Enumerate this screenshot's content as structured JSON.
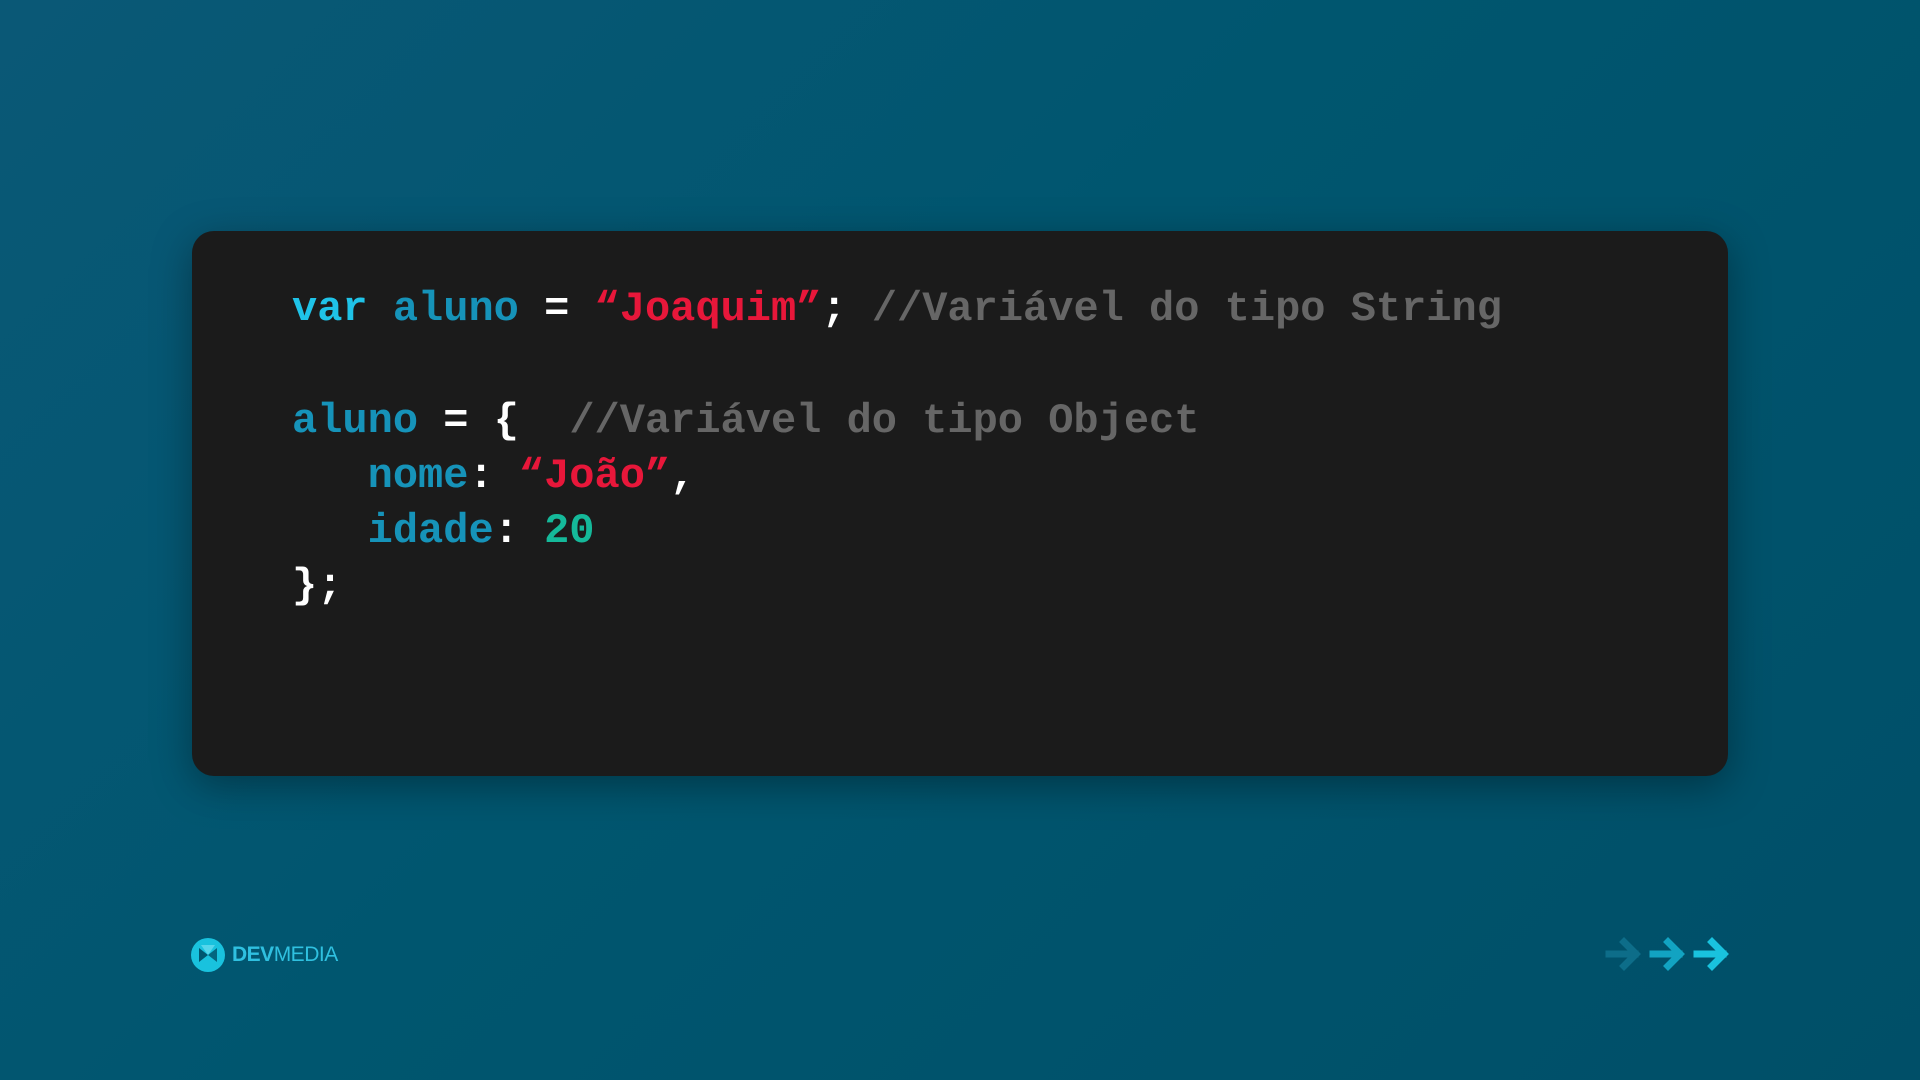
{
  "code": {
    "line1": {
      "keyword": "var",
      "identifier": "aluno",
      "operator": "=",
      "string": "“Joaquim”",
      "semicolon": ";",
      "comment": "//Variável do tipo String"
    },
    "line2": {
      "identifier": "aluno",
      "operator": "=",
      "brace": "{",
      "comment": "//Variável do tipo Object"
    },
    "line3": {
      "key": "nome",
      "colon": ":",
      "string": "“João”",
      "comma": ","
    },
    "line4": {
      "key": "idade",
      "colon": ":",
      "number": "20"
    },
    "line5": {
      "closing": "};"
    }
  },
  "footer": {
    "brand_bold": "DEV",
    "brand_light": "MEDIA",
    "logo_icon": "devmedia-logo-icon",
    "nav_icons": [
      "arrow-right-icon",
      "arrow-right-icon",
      "arrow-right-icon"
    ]
  },
  "colors": {
    "background": "#00566f",
    "card": "#1b1b1b",
    "keyword": "#1fc3e8",
    "identifier": "#1693b9",
    "string": "#e8173a",
    "number": "#15b99a",
    "comment": "#666666",
    "accent": "#19c2de"
  }
}
